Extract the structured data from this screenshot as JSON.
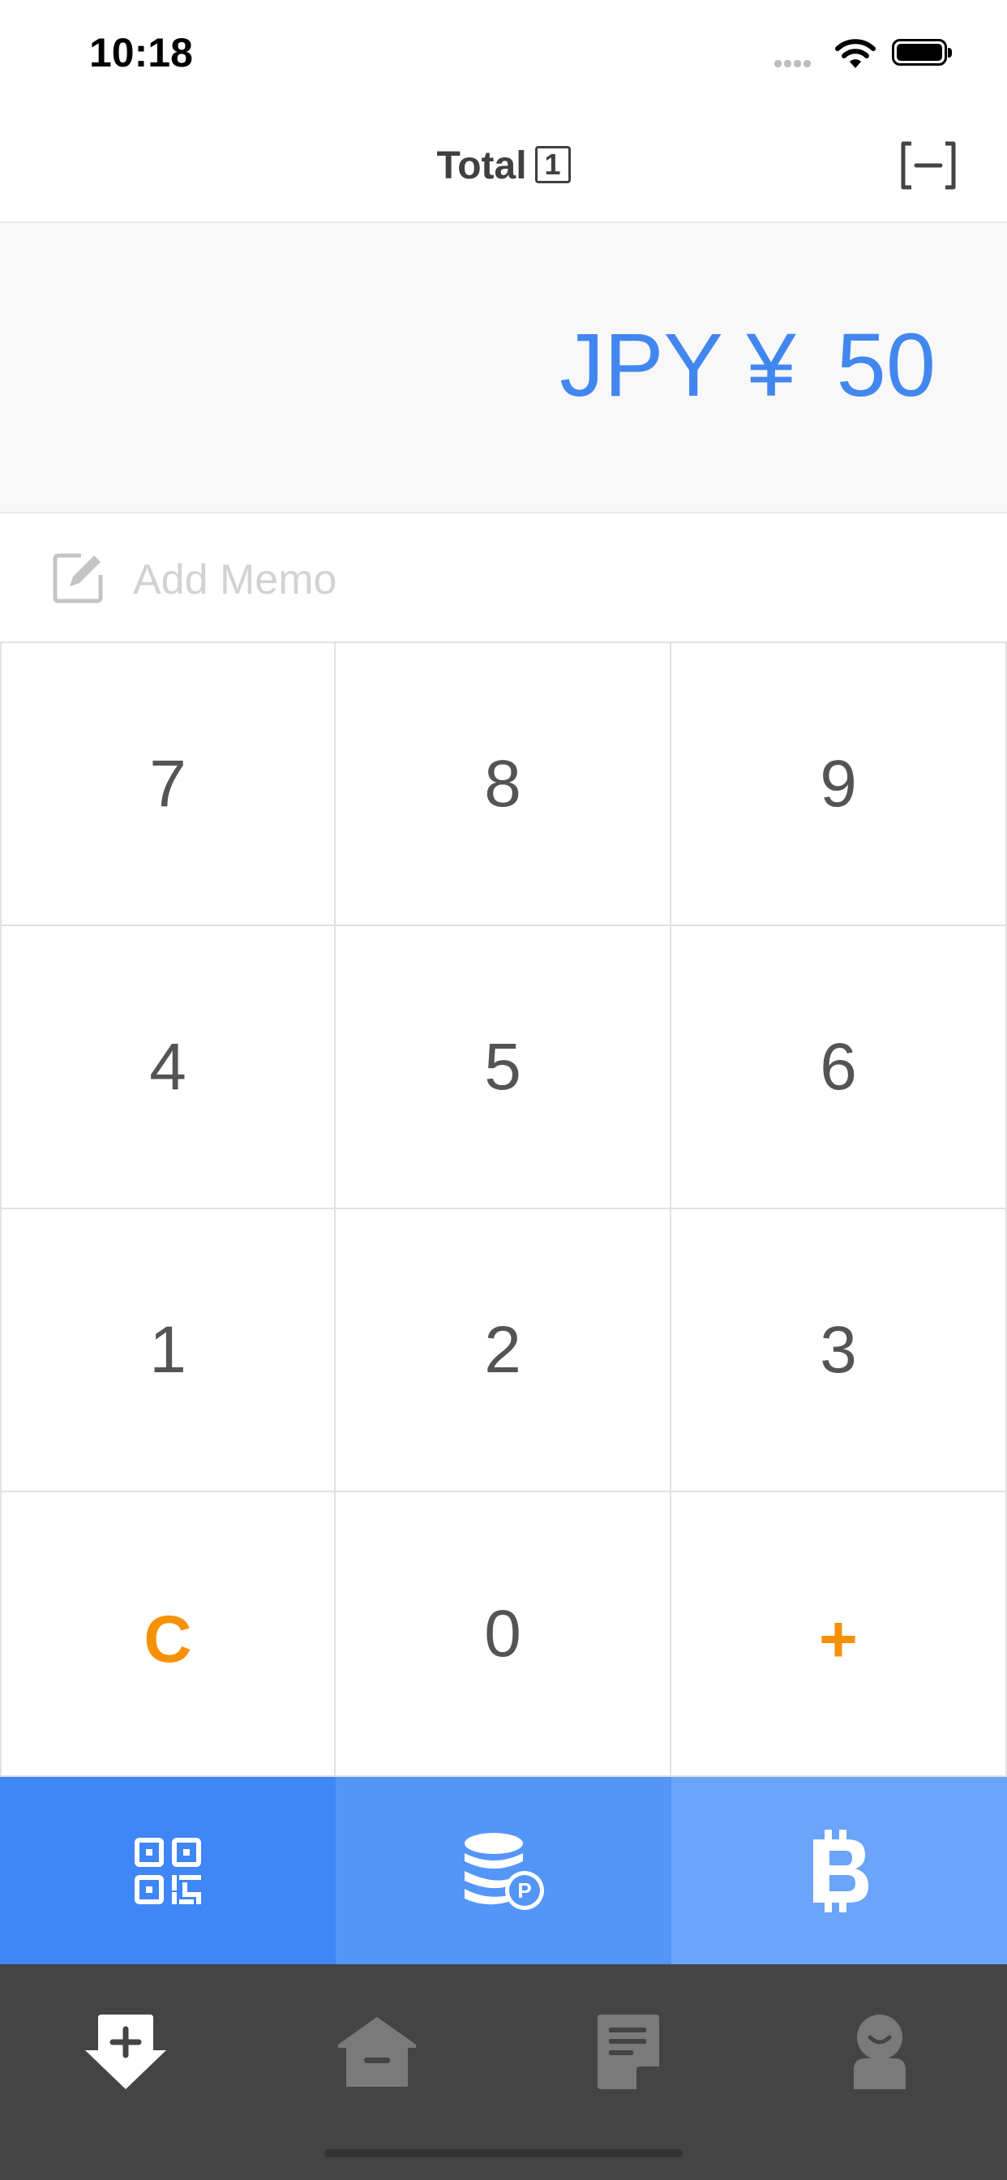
{
  "status_bar": {
    "time": "10:18"
  },
  "nav": {
    "title": "Total",
    "count": "1"
  },
  "amount": {
    "currency": "JPY ¥",
    "value": "50"
  },
  "memo": {
    "placeholder": "Add Memo"
  },
  "keypad": {
    "keys": [
      "7",
      "8",
      "9",
      "4",
      "5",
      "6",
      "1",
      "2",
      "3",
      "C",
      "0",
      "+"
    ]
  },
  "payment_methods": [
    {
      "name": "qr-code",
      "color": "#3f86f7"
    },
    {
      "name": "points",
      "color": "#5495f8"
    },
    {
      "name": "bitcoin",
      "color": "#6ba4fa"
    }
  ],
  "tabs": [
    {
      "icon": "register-add-icon",
      "active": true
    },
    {
      "icon": "home-icon",
      "active": false
    },
    {
      "icon": "receipt-icon",
      "active": false
    },
    {
      "icon": "profile-icon",
      "active": false
    }
  ],
  "colors": {
    "accent": "#4287f0",
    "operator": "#f59105",
    "tabbar": "#444444"
  }
}
